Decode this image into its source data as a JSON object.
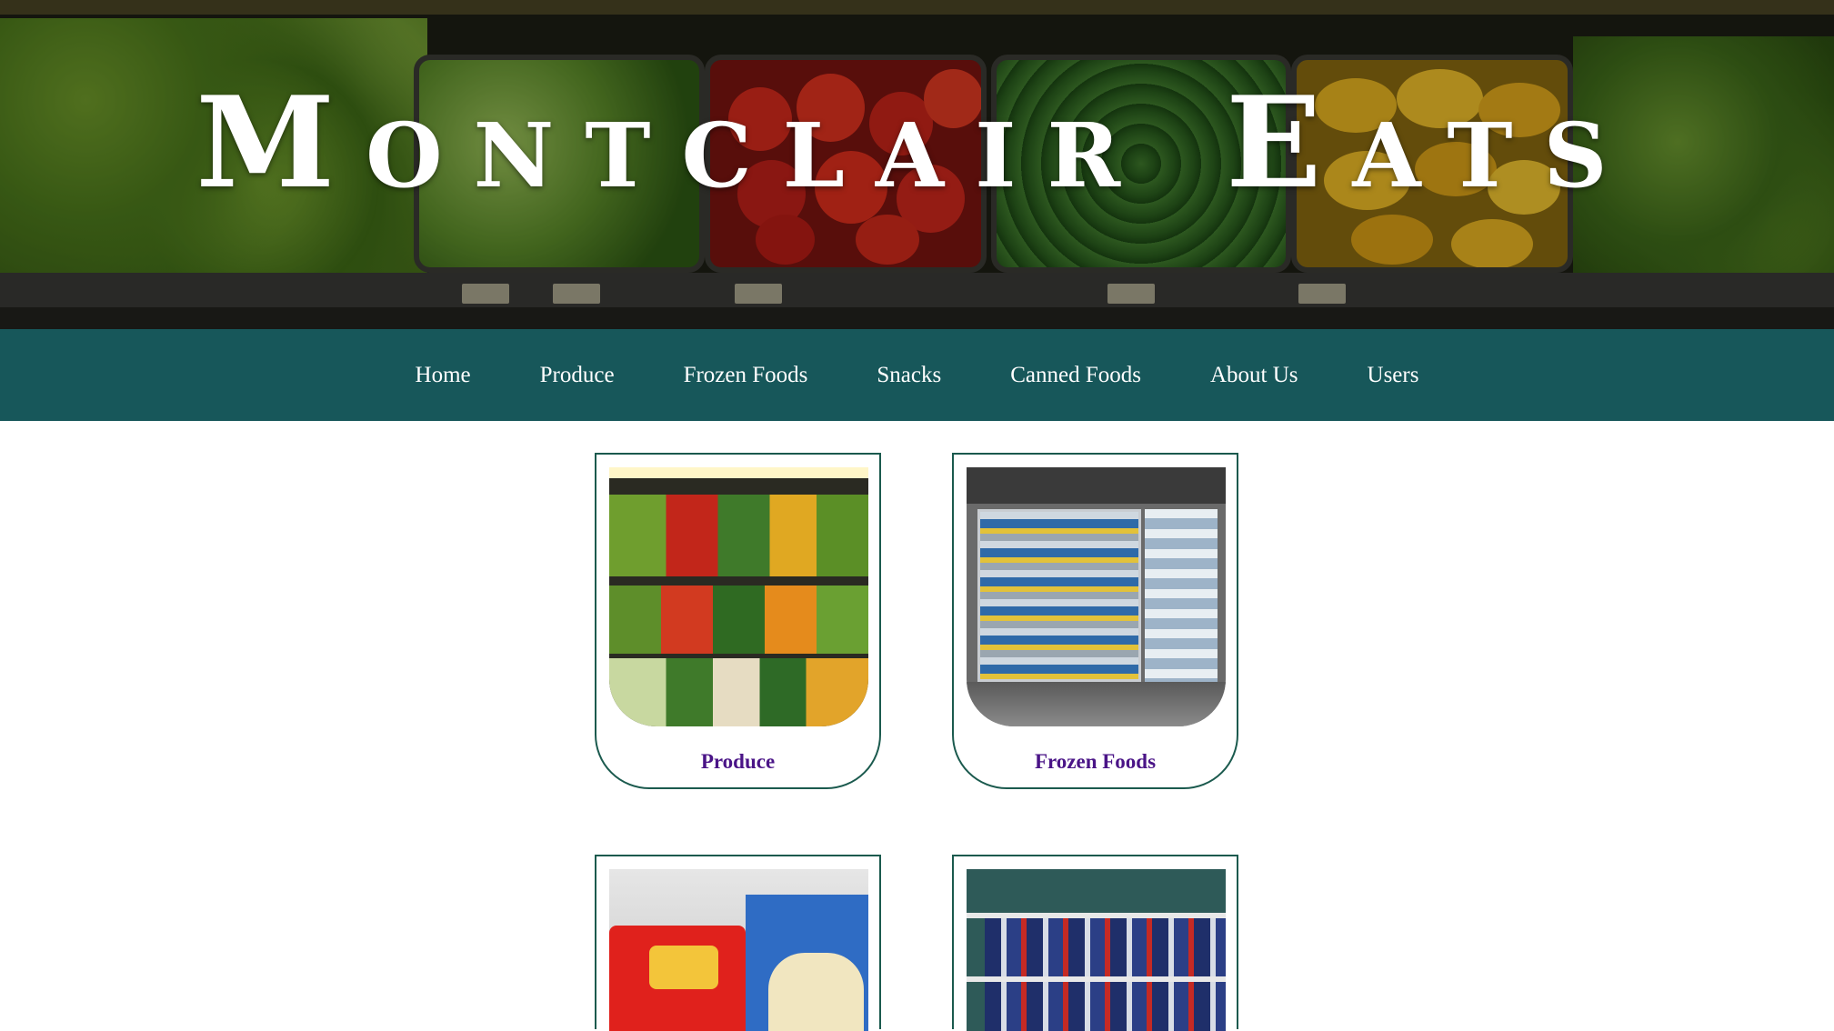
{
  "site": {
    "title": "Montclair Eats"
  },
  "nav": {
    "items": [
      "Home",
      "Produce",
      "Frozen Foods",
      "Snacks",
      "Canned Foods",
      "About Us",
      "Users"
    ]
  },
  "categories": [
    {
      "label": "Produce",
      "image": "produce-shelf-image"
    },
    {
      "label": "Frozen Foods",
      "image": "frozen-aisle-image"
    },
    {
      "label": "",
      "image": "snacks-crackers-image"
    },
    {
      "label": "",
      "image": "canned-goods-shelf-image"
    }
  ],
  "colors": {
    "nav_bg": "#17575a",
    "card_border": "#1b5a4e",
    "card_label": "#4a1487",
    "hero_title": "#ffffff"
  }
}
